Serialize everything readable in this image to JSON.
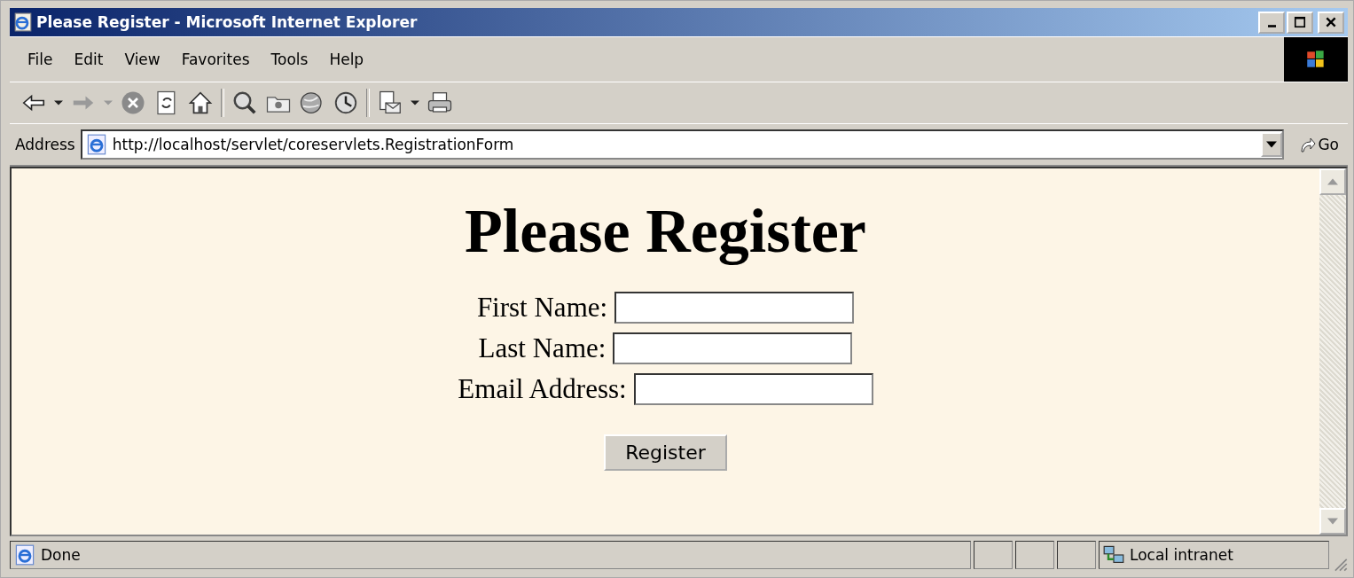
{
  "window": {
    "title": "Please Register - Microsoft Internet Explorer"
  },
  "menu": [
    "File",
    "Edit",
    "View",
    "Favorites",
    "Tools",
    "Help"
  ],
  "address_bar": {
    "label": "Address",
    "url": "http://localhost/servlet/coreservlets.RegistrationForm",
    "go": "Go"
  },
  "page": {
    "heading": "Please Register",
    "fields": [
      {
        "label": "First Name:"
      },
      {
        "label": "Last Name:"
      },
      {
        "label": "Email Address:"
      }
    ],
    "button": "Register"
  },
  "status_bar": {
    "text": "Done",
    "zone": "Local intranet"
  }
}
